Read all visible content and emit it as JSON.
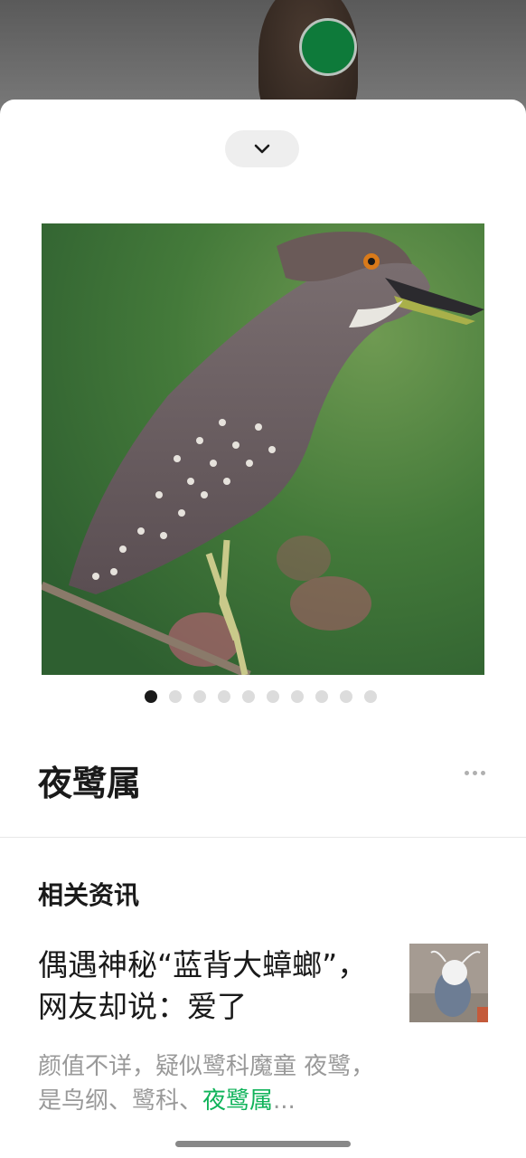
{
  "camera": {
    "shutter_color": "#0e7a3a"
  },
  "sheet": {
    "collapse_icon": "chevron-down-icon",
    "carousel": {
      "total": 10,
      "active": 0
    },
    "species_name": "夜鹭属",
    "more_icon": "more-horizontal-icon",
    "related_section_title": "相关资讯",
    "news": [
      {
        "headline": "偶遇神秘“蓝背大蟑螂”，网友却说：爱了",
        "summary_prefix": "颜值不详，疑似鹭科魔童 夜鹭，是鸟纲、鹭科、",
        "summary_highlight": "夜鹭属",
        "summary_ellipsis": "..."
      }
    ]
  },
  "colors": {
    "accent": "#10b35a",
    "text_primary": "#1a1a1a",
    "text_secondary": "#999999"
  }
}
